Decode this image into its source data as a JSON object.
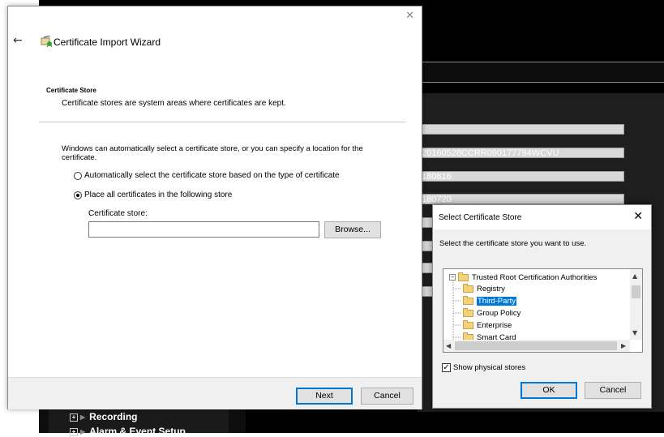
{
  "background_app": {
    "fields": [
      "",
      "20160528CCRR090177794WCVU",
      "180816",
      "180720",
      "",
      "",
      "",
      "",
      ""
    ],
    "tree_items": [
      "Recording",
      "Alarm & Event Setup"
    ]
  },
  "wizard": {
    "close_glyph": "✕",
    "back_glyph": "←",
    "title": "Certificate Import Wizard",
    "section_heading": "Certificate Store",
    "section_description": "Certificate stores are system areas where certificates are kept.",
    "body_text": "Windows can automatically select a certificate store, or you can specify a location for the certificate.",
    "radio_auto": "Automatically select the certificate store based on the type of certificate",
    "radio_place": "Place all certificates in the following store",
    "store_label": "Certificate store:",
    "store_value": "",
    "browse_button": "Browse...",
    "next_button": "Next",
    "cancel_button": "Cancel"
  },
  "select_store_dialog": {
    "title": "Select Certificate Store",
    "close_glyph": "✕",
    "instruction": "Select the certificate store you want to use.",
    "tree": {
      "root": "Trusted Root Certification Authorities",
      "children": [
        "Registry",
        "Third-Party",
        "Group Policy",
        "Enterprise",
        "Smart Card"
      ],
      "selected": "Third-Party"
    },
    "show_physical_stores_label": "Show physical stores",
    "show_physical_stores_checked": true,
    "ok_button": "OK",
    "cancel_button": "Cancel"
  },
  "colors": {
    "selection": "#0078d7",
    "folder": "#f3d27a"
  }
}
